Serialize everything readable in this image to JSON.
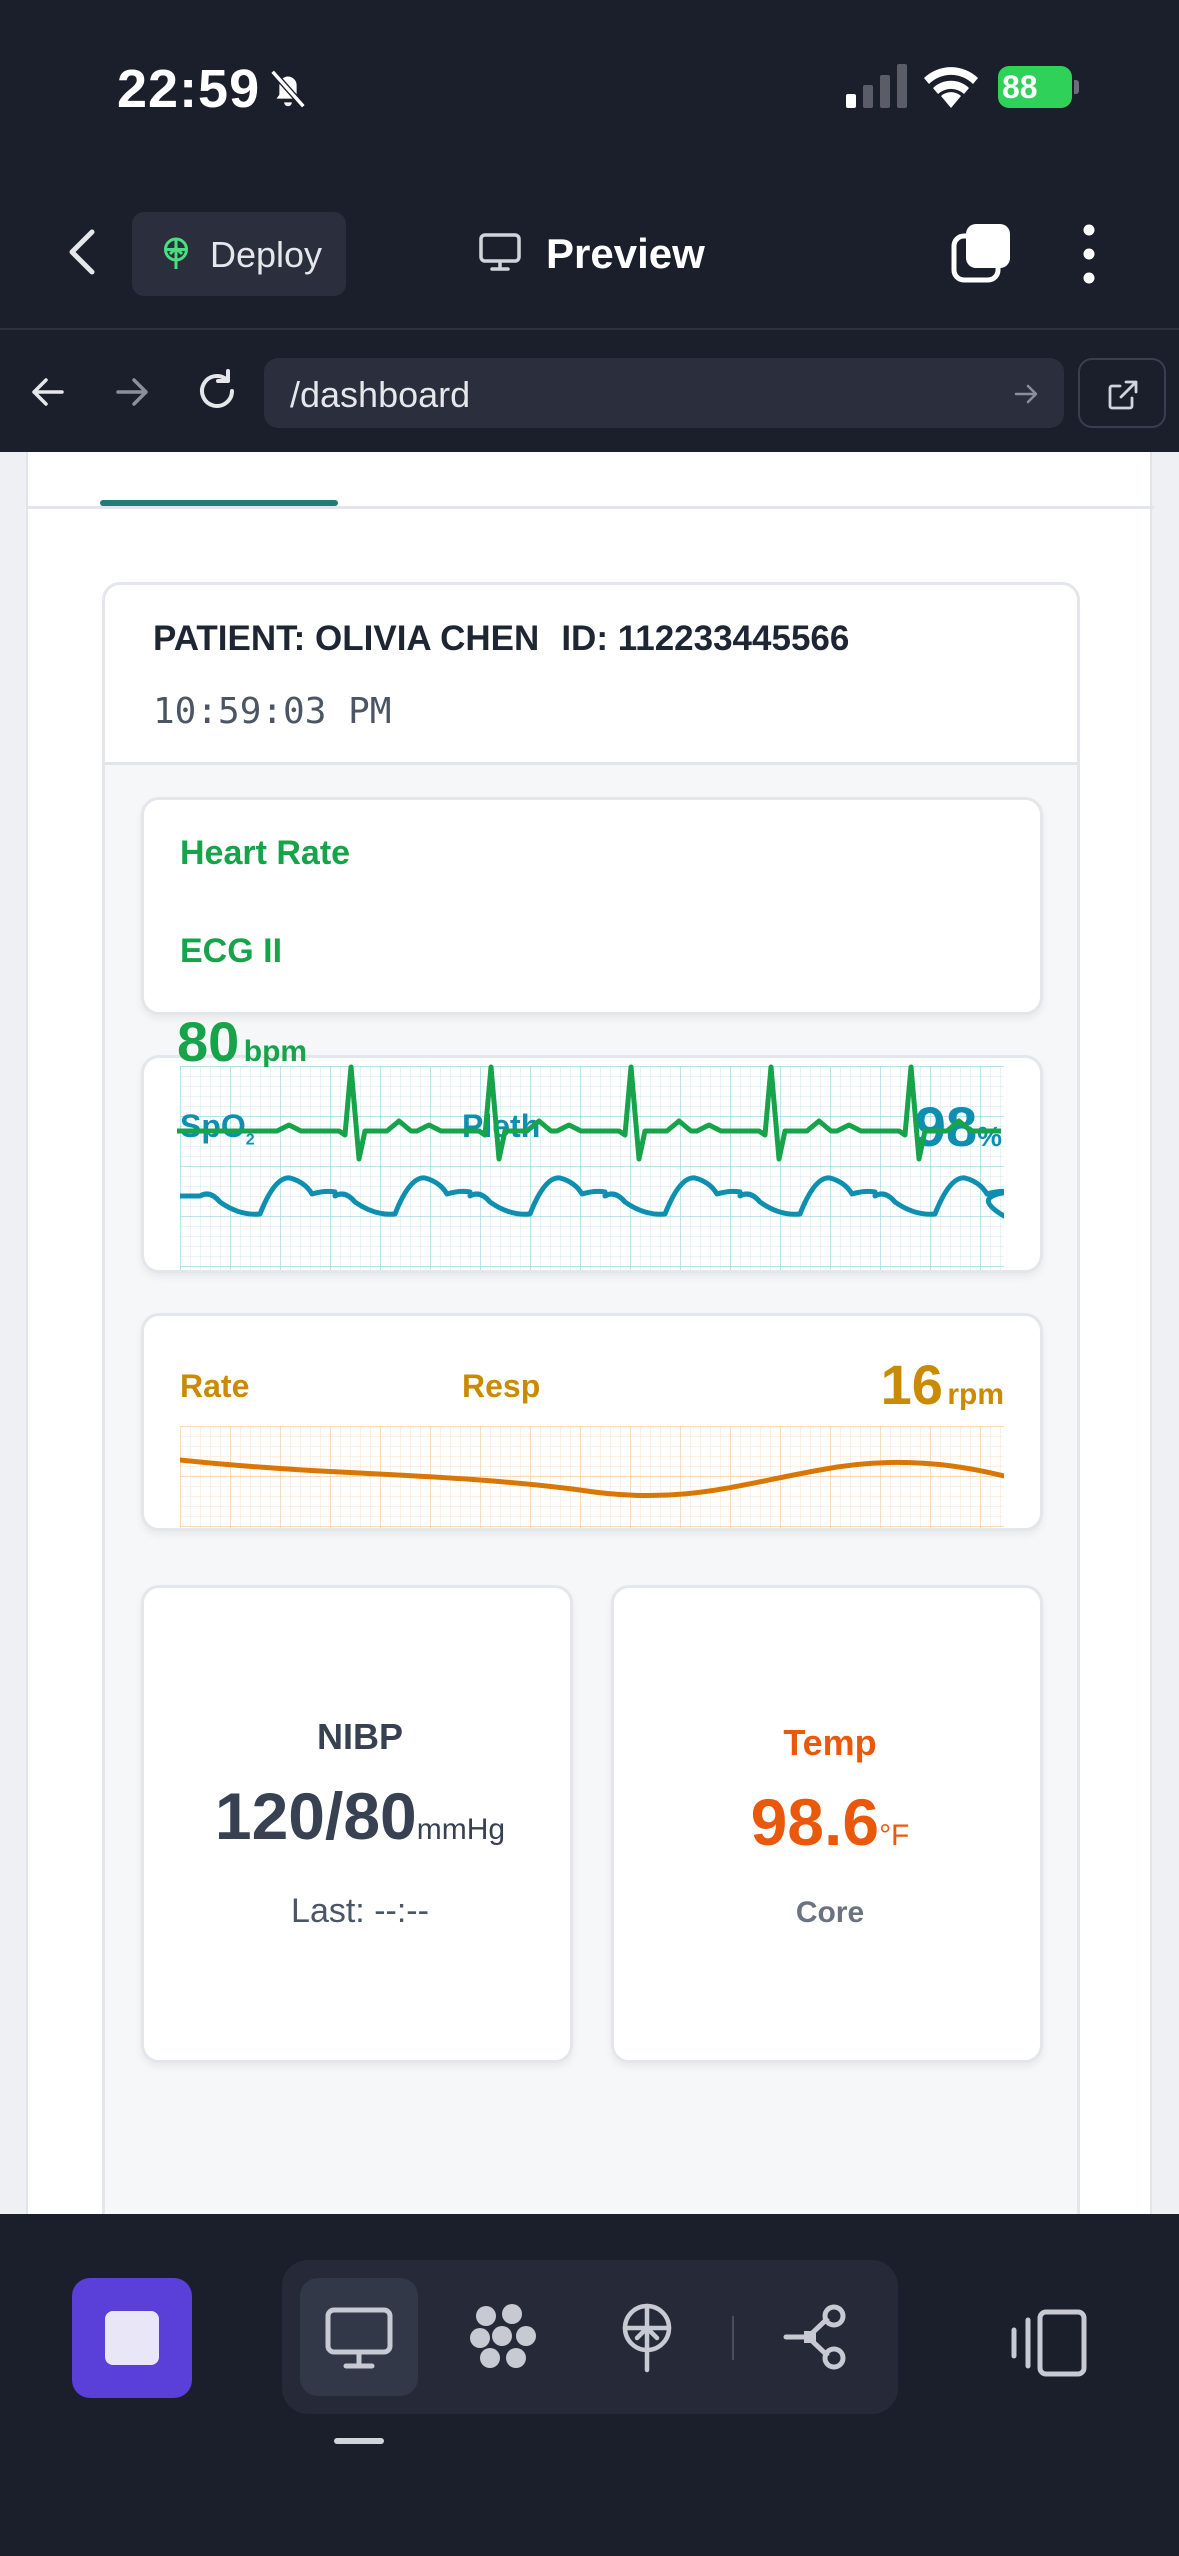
{
  "status_bar": {
    "time": "22:59",
    "battery": "88"
  },
  "app_bar": {
    "deploy_label": "Deploy",
    "preview_label": "Preview"
  },
  "address_bar": {
    "url": "/dashboard"
  },
  "monitor": {
    "patient_label": "PATIENT: OLIVIA CHEN",
    "id_label": "ID: 112233445566",
    "clock": "10:59:03 PM",
    "heart_rate": {
      "title": "Heart Rate",
      "lead": "ECG II",
      "value": "80",
      "unit": "bpm",
      "color": "#16a34a"
    },
    "spo2": {
      "label_main": "SpO",
      "label_sub": "2",
      "pleth_label": "Pleth",
      "value": "98",
      "unit": "%",
      "color": "#0e8fb0"
    },
    "resp": {
      "rate_label": "Rate",
      "resp_label": "Resp",
      "value": "16",
      "unit": "rpm",
      "color": "#ca8a04",
      "wave_color": "#d97706"
    },
    "nibp": {
      "title": "NIBP",
      "value": "120/80",
      "unit": "mmHg",
      "last": "Last: --:--"
    },
    "temp": {
      "title": "Temp",
      "value": "98.6",
      "unit": "°F",
      "site": "Core",
      "color": "#ea580c"
    }
  },
  "dock": {
    "tools": [
      "monitor-icon",
      "grid-apps-icon",
      "deploy-icon",
      "share-nodes-icon"
    ]
  }
}
